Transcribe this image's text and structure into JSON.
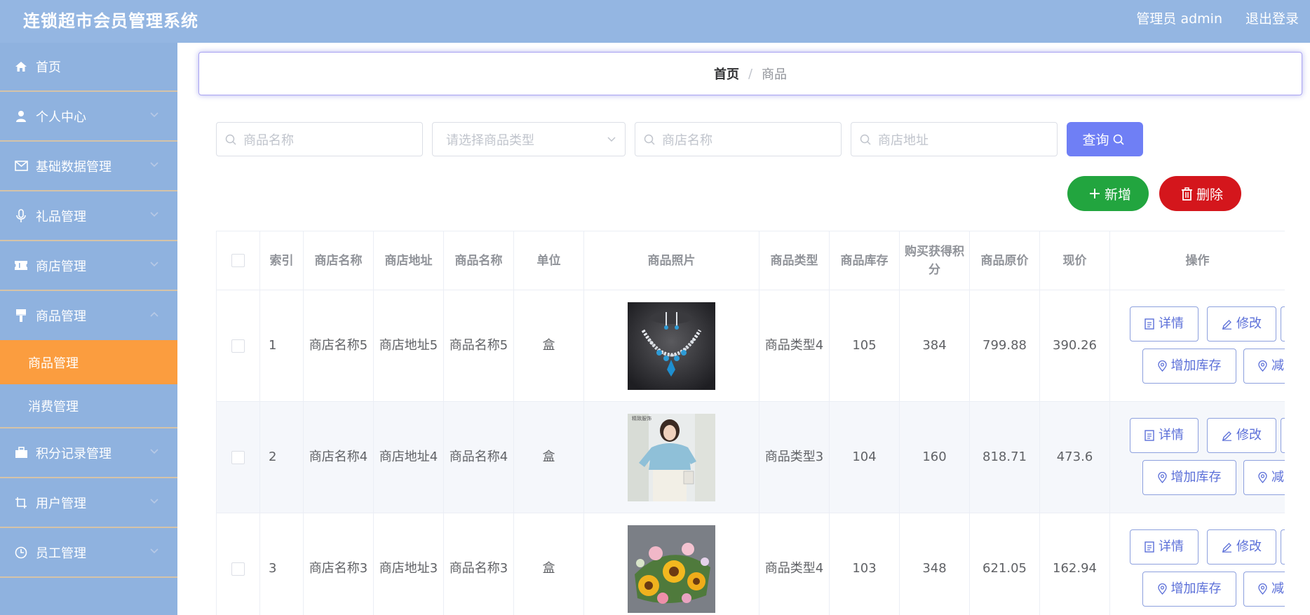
{
  "header": {
    "title": "连锁超市会员管理系统",
    "admin": "管理员 admin",
    "logout": "退出登录"
  },
  "sidebar": {
    "items": [
      {
        "label": "首页",
        "icon": "home-icon"
      },
      {
        "label": "个人中心",
        "icon": "user-icon"
      },
      {
        "label": "基础数据管理",
        "icon": "mail-icon"
      },
      {
        "label": "礼品管理",
        "icon": "mic-icon"
      },
      {
        "label": "商店管理",
        "icon": "ticket-icon"
      },
      {
        "label": "商品管理",
        "icon": "brush-icon",
        "expanded": true
      },
      {
        "label": "积分记录管理",
        "icon": "briefcase-icon"
      },
      {
        "label": "用户管理",
        "icon": "crop-icon"
      },
      {
        "label": "员工管理",
        "icon": "clock-icon"
      }
    ],
    "sub_items": [
      {
        "label": "商品管理",
        "active": true
      },
      {
        "label": "消费管理",
        "active": false
      }
    ],
    "active_color": "#fb9d3f"
  },
  "breadcrumb": {
    "home": "首页",
    "separator": "/",
    "current": "商品"
  },
  "search": {
    "product_name_placeholder": "商品名称",
    "product_type_placeholder": "请选择商品类型",
    "shop_name_placeholder": "商店名称",
    "shop_address_placeholder": "商店地址",
    "query_label": "查询"
  },
  "actions": {
    "add_label": "新增",
    "delete_label": "删除"
  },
  "table": {
    "columns": {
      "index": "索引",
      "shop_name": "商店名称",
      "shop_address": "商店地址",
      "product_name": "商品名称",
      "unit": "单位",
      "photo": "商品照片",
      "type": "商品类型",
      "stock": "商品库存",
      "points": "购买获得积分",
      "original_price": "商品原价",
      "current_price": "现价",
      "operations": "操作"
    },
    "rows": [
      {
        "index": "1",
        "shop_name": "商店名称5",
        "shop_address": "商店地址5",
        "product_name": "商品名称5",
        "unit": "盒",
        "photo": "necklace-photo",
        "type": "商品类型4",
        "stock": "105",
        "points": "384",
        "original_price": "799.88",
        "current_price": "390.26"
      },
      {
        "index": "2",
        "shop_name": "商店名称4",
        "shop_address": "商店地址4",
        "product_name": "商品名称4",
        "unit": "盒",
        "photo": "blouse-photo",
        "type": "商品类型3",
        "stock": "104",
        "points": "160",
        "original_price": "818.71",
        "current_price": "473.6"
      },
      {
        "index": "3",
        "shop_name": "商店名称3",
        "shop_address": "商店地址3",
        "product_name": "商品名称3",
        "unit": "盒",
        "photo": "flowers-photo",
        "type": "商品类型4",
        "stock": "103",
        "points": "348",
        "original_price": "621.05",
        "current_price": "162.94"
      }
    ],
    "row_actions": {
      "detail": "详情",
      "edit": "修改",
      "add_stock": "增加库存",
      "reduce_stock_partial": "减"
    },
    "photo_overlay_text": "精致服饰"
  },
  "colors": {
    "header_bg": "#94b6e2",
    "sidebar_bg": "#8fb2df",
    "query_button": "#6f7ff5",
    "add_button": "#22a53f",
    "delete_button": "#d4161c",
    "op_button_text": "#5b6fd8"
  }
}
